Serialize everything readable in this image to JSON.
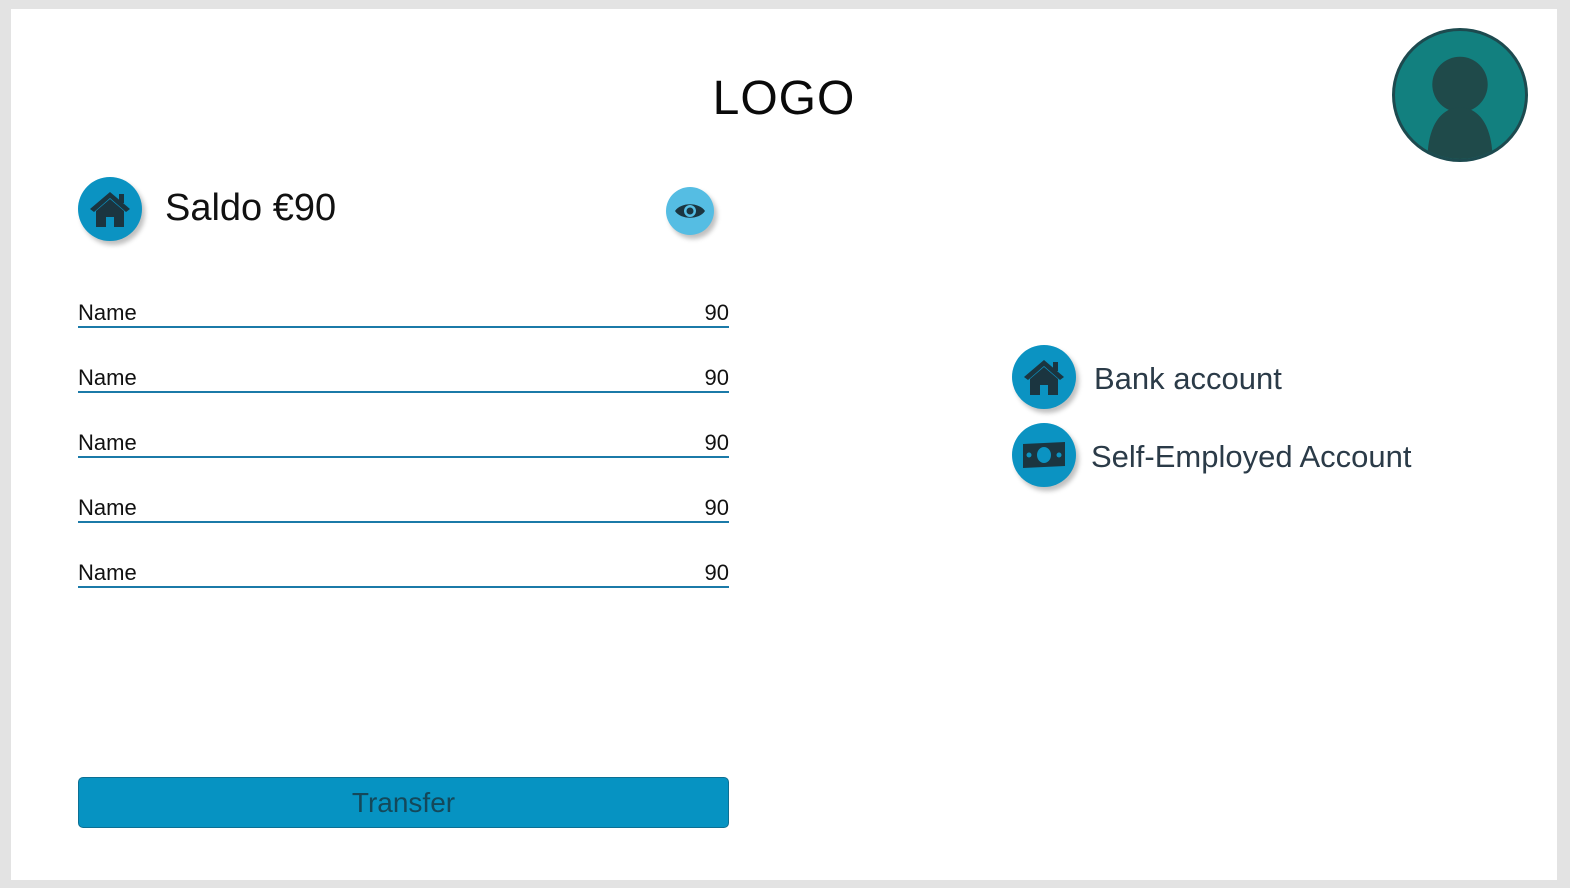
{
  "header": {
    "logo_text": "LOGO"
  },
  "icons": {
    "avatar": "user-avatar-icon",
    "home": "home-icon",
    "eye": "eye-icon",
    "money": "banknote-icon"
  },
  "balance": {
    "label": "Saldo €90"
  },
  "rows": [
    {
      "name": "Name",
      "amount": "90"
    },
    {
      "name": "Name",
      "amount": "90"
    },
    {
      "name": "Name",
      "amount": "90"
    },
    {
      "name": "Name",
      "amount": "90"
    },
    {
      "name": "Name",
      "amount": "90"
    }
  ],
  "actions": {
    "transfer_label": "Transfer"
  },
  "accounts": [
    {
      "label": "Bank account",
      "icon": "home-icon"
    },
    {
      "label": "Self-Employed Account",
      "icon": "banknote-icon"
    }
  ],
  "colors": {
    "accent": "#0b93c2",
    "eye_accent": "#55bde3",
    "avatar_bg": "#12807f",
    "line": "#1b7aa8"
  }
}
